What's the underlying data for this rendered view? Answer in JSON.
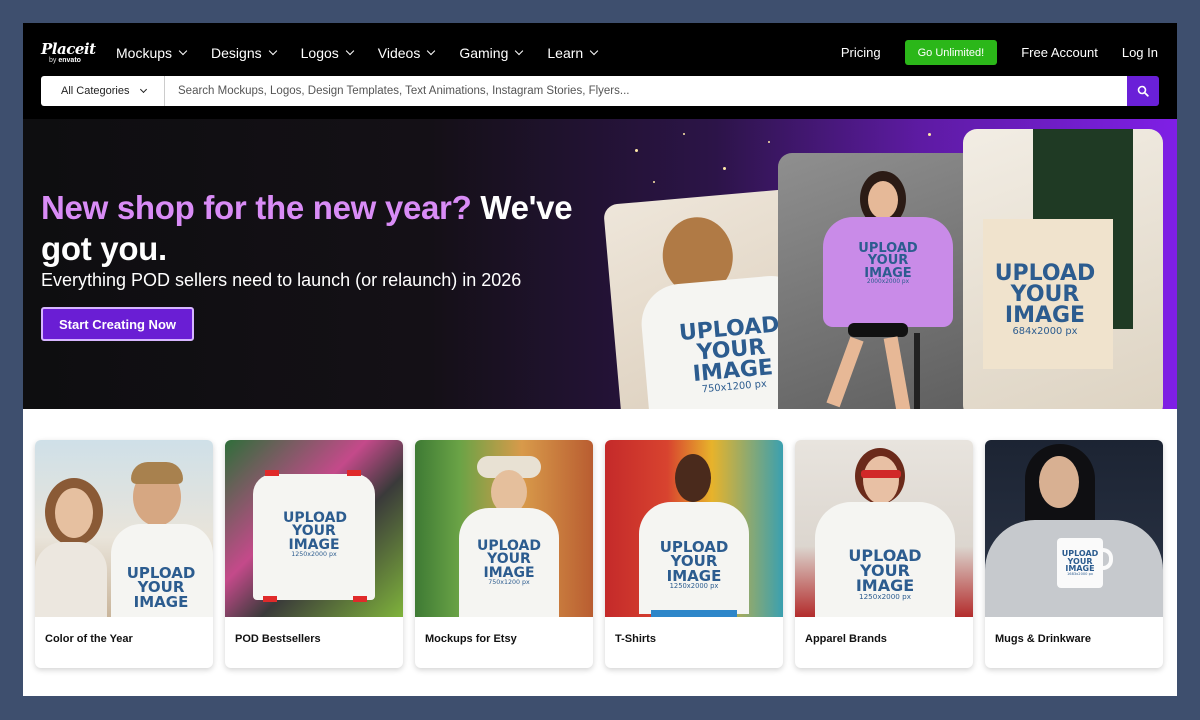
{
  "brand": {
    "name": "Placeit",
    "by": "by",
    "parent": "envato"
  },
  "nav": {
    "menu": [
      {
        "label": "Mockups"
      },
      {
        "label": "Designs"
      },
      {
        "label": "Logos"
      },
      {
        "label": "Videos"
      },
      {
        "label": "Gaming"
      },
      {
        "label": "Learn"
      }
    ],
    "pricing": "Pricing",
    "cta": "Go Unlimited!",
    "free_account": "Free Account",
    "login": "Log In"
  },
  "search": {
    "category": "All Categories",
    "placeholder": "Search Mockups, Logos, Design Templates, Text Animations, Instagram Stories, Flyers..."
  },
  "hero": {
    "title_highlight": "New shop for the new year?",
    "title_rest": " We've got you.",
    "subtitle": "Everything POD sellers need to launch (or relaunch) in 2026",
    "cta": "Start Creating Now",
    "mockups": [
      {
        "line1": "UPLOAD",
        "line2": "YOUR",
        "line3": "IMAGE",
        "size": "750x1200 px"
      },
      {
        "line1": "UPLOAD",
        "line2": "YOUR",
        "line3": "IMAGE",
        "size": "2000x2000 px"
      },
      {
        "line1": "UPLOAD",
        "line2": "YOUR",
        "line3": "IMAGE",
        "size": "684x2000 px"
      }
    ]
  },
  "categories": [
    {
      "label": "Color of the Year",
      "upload": "UPLOAD YOUR IMAGE",
      "size": ""
    },
    {
      "label": "POD Bestsellers",
      "upload": "UPLOAD YOUR IMAGE",
      "size": "1250x2000 px"
    },
    {
      "label": "Mockups for Etsy",
      "upload": "UPLOAD YOUR IMAGE",
      "size": "750x1200 px"
    },
    {
      "label": "T-Shirts",
      "upload": "UPLOAD YOUR IMAGE",
      "size": "1250x2000 px"
    },
    {
      "label": "Apparel Brands",
      "upload": "UPLOAD YOUR IMAGE",
      "size": "1250x2000 px"
    },
    {
      "label": "Mugs & Drinkware",
      "upload": "UPLOAD YOUR IMAGE",
      "size": "1683x2000 px"
    }
  ],
  "colors": {
    "accent_purple": "#6a1ed4",
    "cta_green": "#2bb719",
    "title_highlight": "#d98cf6",
    "mockup_blue": "#2c5c8f"
  },
  "icons": [
    "chevron-down-icon",
    "search-icon"
  ]
}
